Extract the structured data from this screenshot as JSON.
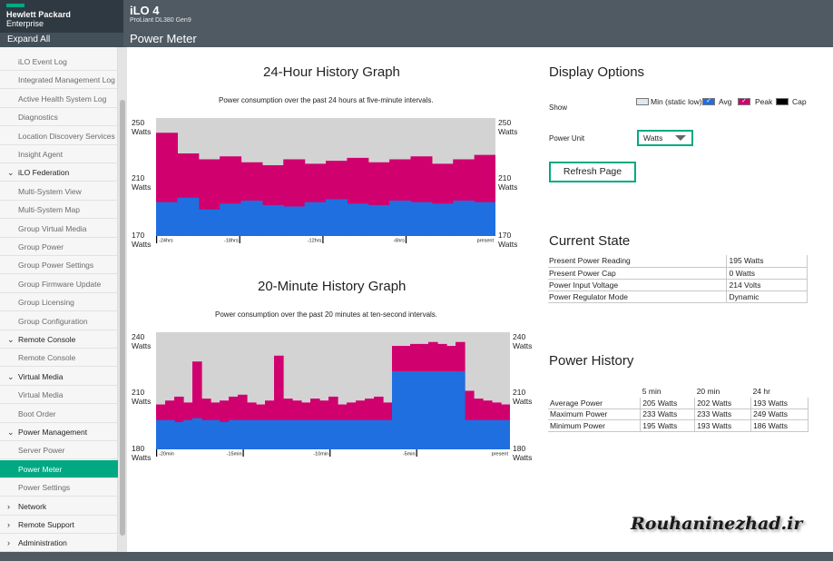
{
  "header": {
    "brand_line1": "Hewlett Packard",
    "brand_line2": "Enterprise",
    "app_title": "iLO 4",
    "app_subtitle": "ProLiant DL380 Gen9",
    "page_title": "Power Meter",
    "expand_all": "Expand All"
  },
  "sidebar": {
    "items": [
      {
        "label": "iLO Event Log",
        "type": "child"
      },
      {
        "label": "Integrated Management Log",
        "type": "child"
      },
      {
        "label": "Active Health System Log",
        "type": "child"
      },
      {
        "label": "Diagnostics",
        "type": "child"
      },
      {
        "label": "Location Discovery Services",
        "type": "child"
      },
      {
        "label": "Insight Agent",
        "type": "child"
      },
      {
        "label": "iLO Federation",
        "type": "section",
        "caret": "⌄"
      },
      {
        "label": "Multi-System View",
        "type": "child"
      },
      {
        "label": "Multi-System Map",
        "type": "child"
      },
      {
        "label": "Group Virtual Media",
        "type": "child"
      },
      {
        "label": "Group Power",
        "type": "child"
      },
      {
        "label": "Group Power Settings",
        "type": "child"
      },
      {
        "label": "Group Firmware Update",
        "type": "child"
      },
      {
        "label": "Group Licensing",
        "type": "child"
      },
      {
        "label": "Group Configuration",
        "type": "child"
      },
      {
        "label": "Remote Console",
        "type": "section",
        "caret": "⌄"
      },
      {
        "label": "Remote Console",
        "type": "child"
      },
      {
        "label": "Virtual Media",
        "type": "section",
        "caret": "⌄"
      },
      {
        "label": "Virtual Media",
        "type": "child"
      },
      {
        "label": "Boot Order",
        "type": "child"
      },
      {
        "label": "Power Management",
        "type": "section",
        "caret": "⌄"
      },
      {
        "label": "Server Power",
        "type": "child"
      },
      {
        "label": "Power Meter",
        "type": "child",
        "active": true
      },
      {
        "label": "Power Settings",
        "type": "child"
      },
      {
        "label": "Network",
        "type": "section",
        "caret": "›"
      },
      {
        "label": "Remote Support",
        "type": "section",
        "caret": "›"
      },
      {
        "label": "Administration",
        "type": "section",
        "caret": "›"
      }
    ]
  },
  "graph24": {
    "title": "24-Hour History Graph",
    "subtitle": "Power consumption over the past 24 hours at five-minute intervals.",
    "y_labels": [
      {
        "value": "250",
        "unit": "Watts"
      },
      {
        "value": "210",
        "unit": "Watts"
      },
      {
        "value": "170",
        "unit": "Watts"
      }
    ]
  },
  "graph20": {
    "title": "20-Minute History Graph",
    "subtitle": "Power consumption over the past 20 minutes at ten-second intervals.",
    "y_labels": [
      {
        "value": "240",
        "unit": "Watts"
      },
      {
        "value": "210",
        "unit": "Watts"
      },
      {
        "value": "180",
        "unit": "Watts"
      }
    ]
  },
  "chart_data": [
    {
      "type": "area",
      "title": "24-Hour History Graph",
      "x_ticks": [
        "-24hrs",
        "-18hrs",
        "-12hrs",
        "-6hrs",
        "present"
      ],
      "ylim": [
        170,
        250
      ],
      "y_ticks": [
        170,
        210,
        250
      ],
      "y_unit": "Watts",
      "series": [
        {
          "name": "Avg",
          "color": "#1f6fe0",
          "values": [
            193,
            196,
            188,
            192,
            194,
            191,
            190,
            193,
            195,
            192,
            191,
            194,
            193,
            192,
            194,
            193
          ]
        },
        {
          "name": "Peak",
          "color": "#d0006f",
          "values": [
            240,
            226,
            222,
            224,
            220,
            218,
            222,
            219,
            221,
            223,
            220,
            222,
            224,
            219,
            222,
            225
          ]
        }
      ]
    },
    {
      "type": "area",
      "title": "20-Minute History Graph",
      "x_ticks": [
        "-20min",
        "-15min",
        "-10min",
        "-5min",
        "present"
      ],
      "ylim": [
        180,
        240
      ],
      "y_ticks": [
        180,
        210,
        240
      ],
      "y_unit": "Watts",
      "series": [
        {
          "name": "Avg",
          "color": "#1f6fe0",
          "values": [
            195,
            195,
            194,
            195,
            196,
            195,
            195,
            194,
            195,
            195,
            195,
            195,
            195,
            195,
            195,
            195,
            195,
            195,
            195,
            195,
            195,
            195,
            195,
            195,
            195,
            195,
            220,
            220,
            220,
            220,
            220,
            220,
            220,
            220,
            195,
            195,
            195,
            195,
            195
          ]
        },
        {
          "name": "Peak",
          "color": "#d0006f",
          "values": [
            203,
            205,
            207,
            204,
            225,
            206,
            204,
            205,
            207,
            208,
            204,
            203,
            205,
            228,
            206,
            205,
            204,
            206,
            205,
            207,
            203,
            204,
            205,
            206,
            207,
            204,
            233,
            233,
            234,
            234,
            235,
            234,
            233,
            235,
            210,
            206,
            205,
            204,
            203
          ]
        }
      ]
    }
  ],
  "display_options": {
    "title": "Display Options",
    "show_label": "Show",
    "checkboxes": [
      {
        "label": "Min (static low)",
        "color": "#dfe7f2",
        "checked": false
      },
      {
        "label": "Avg",
        "color": "#1f6fe0",
        "checked": true
      },
      {
        "label": "Peak",
        "color": "#d0006f",
        "checked": true
      },
      {
        "label": "Cap",
        "color": "#000000",
        "checked": false
      }
    ],
    "power_unit_label": "Power Unit",
    "power_unit_value": "Watts",
    "refresh_label": "Refresh Page"
  },
  "current_state": {
    "title": "Current State",
    "rows": [
      {
        "label": "Present Power Reading",
        "value": "195 Watts"
      },
      {
        "label": "Present Power Cap",
        "value": "0 Watts"
      },
      {
        "label": "Power Input Voltage",
        "value": "214 Volts"
      },
      {
        "label": "Power Regulator Mode",
        "value": "Dynamic"
      }
    ]
  },
  "power_history": {
    "title": "Power History",
    "columns": [
      "5 min",
      "20 min",
      "24 hr"
    ],
    "rows": [
      {
        "label": "Average Power",
        "values": [
          "205 Watts",
          "202 Watts",
          "193 Watts"
        ]
      },
      {
        "label": "Maximum Power",
        "values": [
          "233 Watts",
          "233 Watts",
          "249 Watts"
        ]
      },
      {
        "label": "Minimum Power",
        "values": [
          "195 Watts",
          "193 Watts",
          "186 Watts"
        ]
      }
    ]
  },
  "watermark": "Rouhaninezhad.ir"
}
